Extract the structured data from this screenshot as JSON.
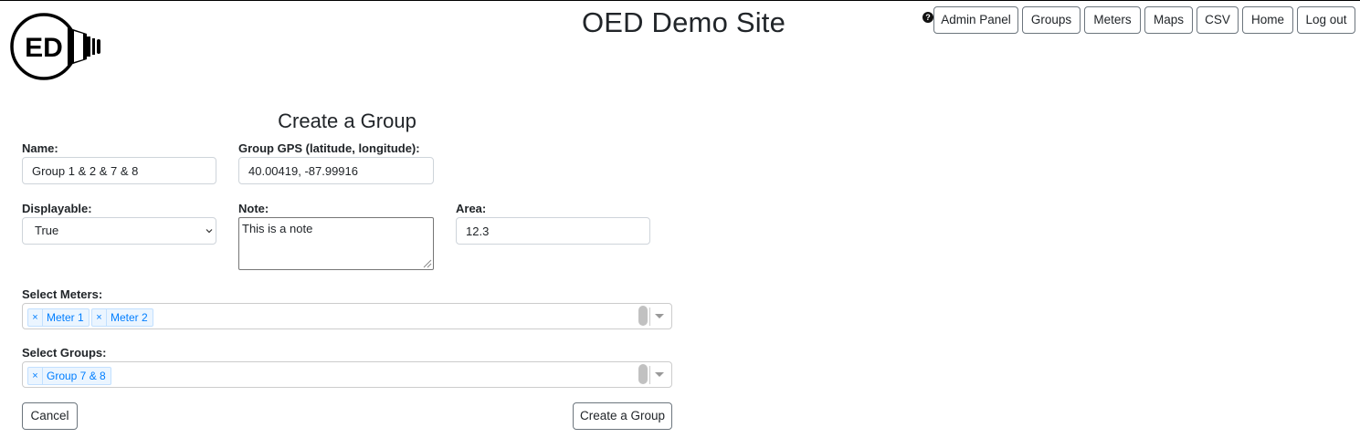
{
  "header": {
    "site_title": "OED Demo Site",
    "logo_text": "ED",
    "help_icon": "?",
    "nav": [
      "Admin Panel",
      "Groups",
      "Meters",
      "Maps",
      "CSV",
      "Home",
      "Log out"
    ]
  },
  "form": {
    "title": "Create a Group",
    "name": {
      "label": "Name:",
      "value": "Group 1 & 2 & 7 & 8"
    },
    "gps": {
      "label": "Group GPS (latitude, longitude):",
      "value": "40.00419, -87.99916"
    },
    "displayable": {
      "label": "Displayable:",
      "value": "True"
    },
    "note": {
      "label": "Note:",
      "value": "This is a note"
    },
    "area": {
      "label": "Area:",
      "value": "12.3"
    },
    "meters": {
      "label": "Select Meters:",
      "chips": [
        "Meter 1",
        "Meter 2"
      ],
      "remove_glyph": "×"
    },
    "groups": {
      "label": "Select Groups:",
      "chips": [
        "Group 7 & 8"
      ],
      "remove_glyph": "×"
    },
    "cancel_label": "Cancel",
    "submit_label": "Create a Group"
  },
  "colors": {
    "chip_text": "#007eff",
    "chip_bg": "#ebf5ff",
    "chip_border": "#c2e0ff",
    "button_border": "#6c757d"
  }
}
